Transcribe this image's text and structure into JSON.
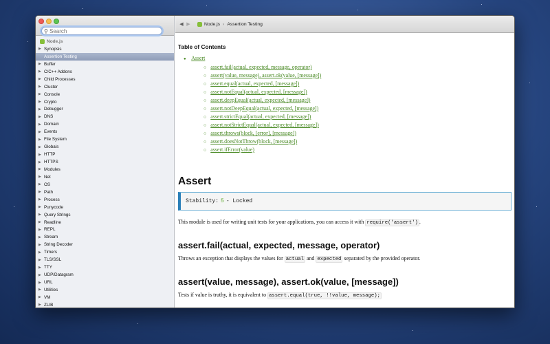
{
  "sidebar": {
    "search_placeholder": "Search",
    "root_label": "Node.js",
    "items": [
      {
        "label": "Synopsis",
        "selected": false
      },
      {
        "label": "Assertion Testing",
        "selected": true
      },
      {
        "label": "Buffer",
        "selected": false
      },
      {
        "label": "C/C++ Addons",
        "selected": false
      },
      {
        "label": "Child Processes",
        "selected": false
      },
      {
        "label": "Cluster",
        "selected": false
      },
      {
        "label": "Console",
        "selected": false
      },
      {
        "label": "Crypto",
        "selected": false
      },
      {
        "label": "Debugger",
        "selected": false
      },
      {
        "label": "DNS",
        "selected": false
      },
      {
        "label": "Domain",
        "selected": false
      },
      {
        "label": "Events",
        "selected": false
      },
      {
        "label": "File System",
        "selected": false
      },
      {
        "label": "Globals",
        "selected": false
      },
      {
        "label": "HTTP",
        "selected": false
      },
      {
        "label": "HTTPS",
        "selected": false
      },
      {
        "label": "Modules",
        "selected": false
      },
      {
        "label": "Net",
        "selected": false
      },
      {
        "label": "OS",
        "selected": false
      },
      {
        "label": "Path",
        "selected": false
      },
      {
        "label": "Process",
        "selected": false
      },
      {
        "label": "Punycode",
        "selected": false
      },
      {
        "label": "Query Strings",
        "selected": false
      },
      {
        "label": "Readline",
        "selected": false
      },
      {
        "label": "REPL",
        "selected": false
      },
      {
        "label": "Stream",
        "selected": false
      },
      {
        "label": "String Decoder",
        "selected": false
      },
      {
        "label": "Timers",
        "selected": false
      },
      {
        "label": "TLS/SSL",
        "selected": false
      },
      {
        "label": "TTY",
        "selected": false
      },
      {
        "label": "UDP/Datagram",
        "selected": false
      },
      {
        "label": "URL",
        "selected": false
      },
      {
        "label": "Utilities",
        "selected": false
      },
      {
        "label": "VM",
        "selected": false
      },
      {
        "label": "ZLIB",
        "selected": false
      }
    ]
  },
  "toolbar": {
    "back_icon": "back-arrow-icon",
    "forward_icon": "forward-arrow-icon",
    "breadcrumb": [
      "Node.js",
      "Assertion Testing"
    ]
  },
  "doc": {
    "toc_title": "Table of Contents",
    "toc_root": "Assert",
    "toc_items": [
      "assert.fail(actual, expected, message, operator)",
      "assert(value, message), assert.ok(value, [message])",
      "assert.equal(actual, expected, [message])",
      "assert.notEqual(actual, expected, [message])",
      "assert.deepEqual(actual, expected, [message])",
      "assert.notDeepEqual(actual, expected, [message])",
      "assert.strictEqual(actual, expected, [message])",
      "assert.notStrictEqual(actual, expected, [message])",
      "assert.throws(block, [error], [message])",
      "assert.doesNotThrow(block, [message])",
      "assert.ifError(value)"
    ],
    "heading": "Assert",
    "stability_label": "Stability:",
    "stability_num": "5",
    "stability_rest": "- Locked",
    "intro_text": "This module is used for writing unit tests for your applications, you can access it with",
    "intro_code": "require('assert')",
    "intro_end": ".",
    "fail_heading": "assert.fail(actual, expected, message, operator)",
    "fail_text_1": "Throws an exception that displays the values for",
    "fail_code_1": "actual",
    "fail_text_2": "and",
    "fail_code_2": "expected",
    "fail_text_3": "separated by the provided operator.",
    "ok_heading": "assert(value, message), assert.ok(value, [message])",
    "ok_text": "Tests if value is truthy, it is equivalent to",
    "ok_code": "assert.equal(true, !!value, message);"
  },
  "colors": {
    "link": "#4a8a25",
    "stability_border": "#2a7fb8",
    "selection": "#8f9db8",
    "node_hex": "#86bf3a"
  }
}
